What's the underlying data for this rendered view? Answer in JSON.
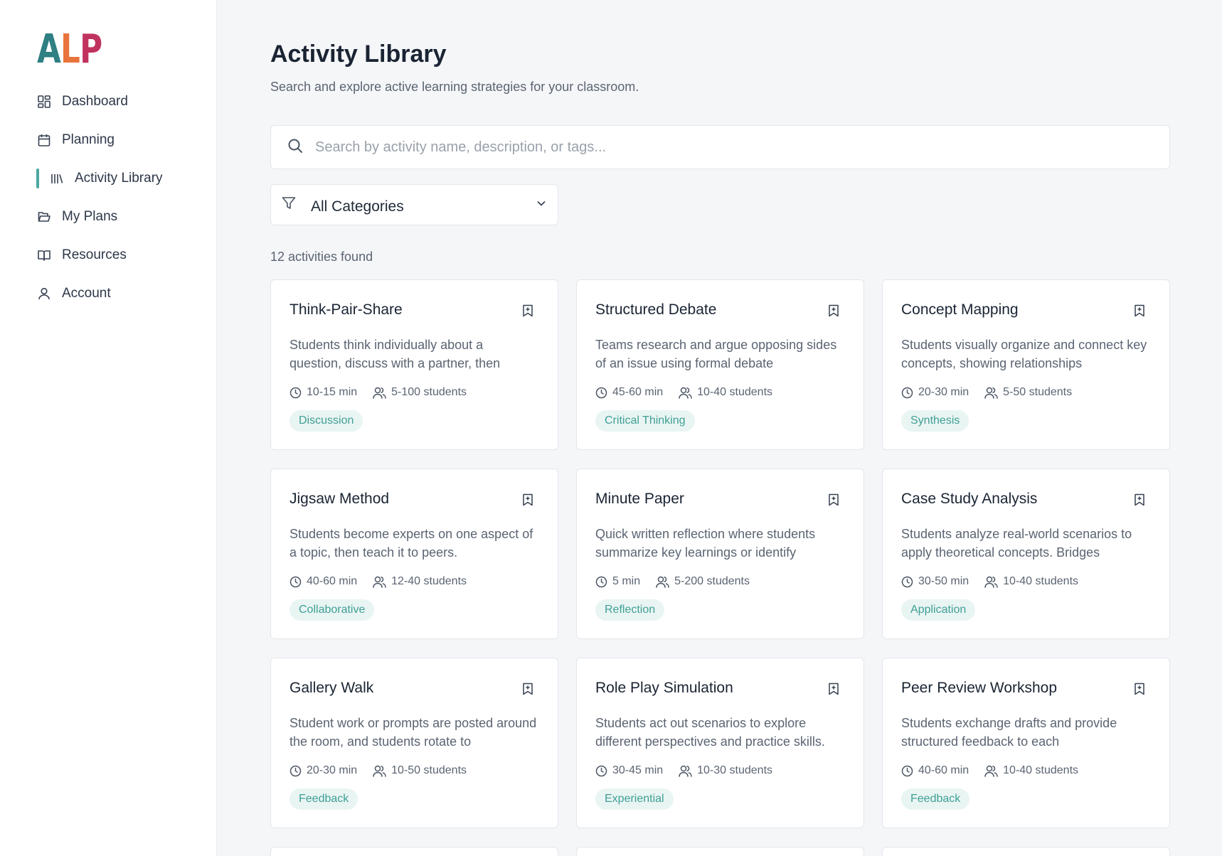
{
  "app": {
    "logo": {
      "letters": [
        "A",
        "L",
        "P"
      ],
      "colors": [
        "#2f7f83",
        "#e8743b",
        "#c0335f"
      ]
    }
  },
  "sidebar": {
    "items": [
      {
        "label": "Dashboard",
        "icon": "dashboard-icon",
        "active": false
      },
      {
        "label": "Planning",
        "icon": "calendar-icon",
        "active": false
      },
      {
        "label": "Activity Library",
        "icon": "library-icon",
        "active": true
      },
      {
        "label": "My Plans",
        "icon": "folder-icon",
        "active": false
      },
      {
        "label": "Resources",
        "icon": "book-icon",
        "active": false
      },
      {
        "label": "Account",
        "icon": "user-icon",
        "active": false
      }
    ],
    "accent": "#4aa8a0"
  },
  "page": {
    "title": "Activity Library",
    "subtitle": "Search and explore active learning strategies for your classroom."
  },
  "search": {
    "placeholder": "Search by activity name, description, or tags...",
    "value": ""
  },
  "filter": {
    "selected": "All Categories"
  },
  "results": {
    "count_text": "12 activities found"
  },
  "activities": [
    {
      "title": "Think-Pair-Share",
      "description": "Students think individually about a question, discuss with a partner, then",
      "duration": "10-15 min",
      "group": "5-100 students",
      "tag": "Discussion"
    },
    {
      "title": "Structured Debate",
      "description": "Teams research and argue opposing sides of an issue using formal debate",
      "duration": "45-60 min",
      "group": "10-40 students",
      "tag": "Critical Thinking"
    },
    {
      "title": "Concept Mapping",
      "description": "Students visually organize and connect key concepts, showing relationships",
      "duration": "20-30 min",
      "group": "5-50 students",
      "tag": "Synthesis"
    },
    {
      "title": "Jigsaw Method",
      "description": "Students become experts on one aspect of a topic, then teach it to peers.",
      "duration": "40-60 min",
      "group": "12-40 students",
      "tag": "Collaborative"
    },
    {
      "title": "Minute Paper",
      "description": "Quick written reflection where students summarize key learnings or identify",
      "duration": "5 min",
      "group": "5-200 students",
      "tag": "Reflection"
    },
    {
      "title": "Case Study Analysis",
      "description": "Students analyze real-world scenarios to apply theoretical concepts. Bridges",
      "duration": "30-50 min",
      "group": "10-40 students",
      "tag": "Application"
    },
    {
      "title": "Gallery Walk",
      "description": "Student work or prompts are posted around the room, and students rotate to",
      "duration": "20-30 min",
      "group": "10-50 students",
      "tag": "Feedback"
    },
    {
      "title": "Role Play Simulation",
      "description": "Students act out scenarios to explore different perspectives and practice skills.",
      "duration": "30-45 min",
      "group": "10-30 students",
      "tag": "Experiential"
    },
    {
      "title": "Peer Review Workshop",
      "description": "Students exchange drafts and provide structured feedback to each",
      "duration": "40-60 min",
      "group": "10-40 students",
      "tag": "Feedback"
    }
  ],
  "colors": {
    "tag_bg": "#e9f5f3",
    "tag_text": "#3f9f95"
  }
}
